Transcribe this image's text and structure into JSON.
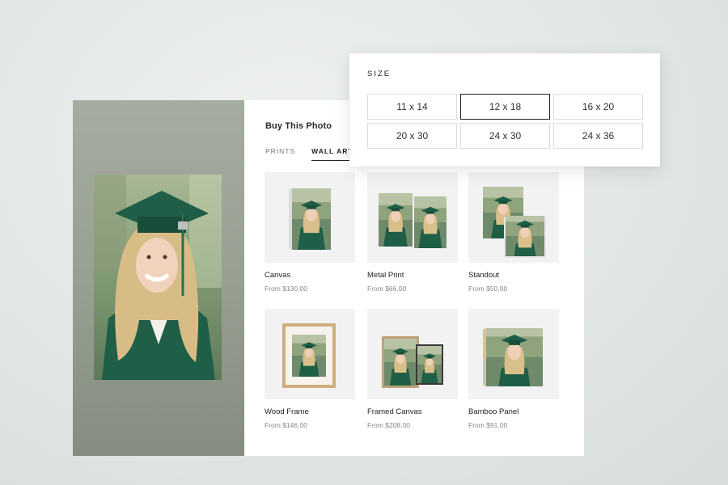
{
  "panel": {
    "title": "Buy This Photo",
    "tabs": [
      {
        "label": "PRINTS",
        "active": false
      },
      {
        "label": "WALL ART",
        "active": true
      }
    ]
  },
  "products": [
    {
      "name": "Canvas",
      "price": "From $130.00"
    },
    {
      "name": "Metal Print",
      "price": "From $66.00"
    },
    {
      "name": "Standout",
      "price": "From $50.00"
    },
    {
      "name": "Wood Frame",
      "price": "From $146.00"
    },
    {
      "name": "Framed Canvas",
      "price": "From $208.00"
    },
    {
      "name": "Bamboo Panel",
      "price": "From $91.00"
    }
  ],
  "size_picker": {
    "label": "SIZE",
    "options": [
      "11 x 14",
      "12 x 18",
      "16 x 20",
      "20 x 30",
      "24 x 30",
      "24 x 36"
    ],
    "selected": "12 x 18"
  },
  "colors": {
    "gown_green": "#1f5e47",
    "accent_dark": "#222222"
  }
}
